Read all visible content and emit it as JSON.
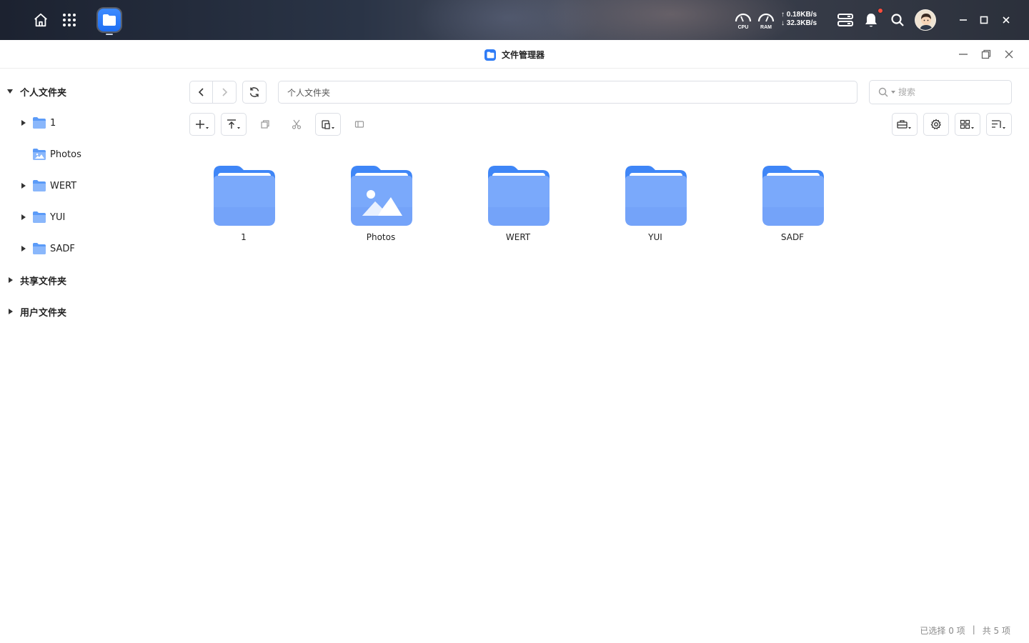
{
  "topbar": {
    "cpu_label": "CPU",
    "ram_label": "RAM",
    "upload_speed": "↑ 0.18KB/s",
    "download_speed": "↓ 32.3KB/s"
  },
  "window": {
    "title": "文件管理器"
  },
  "sidebar": {
    "personal": "个人文件夹",
    "children": [
      {
        "label": "1"
      },
      {
        "label": "Photos"
      },
      {
        "label": "WERT"
      },
      {
        "label": "YUI"
      },
      {
        "label": "SADF"
      }
    ],
    "shared": "共享文件夹",
    "users": "用户文件夹"
  },
  "toolbar": {
    "path": "个人文件夹",
    "search_placeholder": "搜索"
  },
  "items": [
    {
      "name": "1",
      "type": "folder"
    },
    {
      "name": "Photos",
      "type": "photos-folder"
    },
    {
      "name": "WERT",
      "type": "folder"
    },
    {
      "name": "YUI",
      "type": "folder"
    },
    {
      "name": "SADF",
      "type": "folder"
    }
  ],
  "status": {
    "selected": "已选择 0 项",
    "separator": "|",
    "total": "共 5 项"
  },
  "colors": {
    "folder_front": "#7aa9fb",
    "folder_back": "#3f86f7",
    "accent": "#2f7cf6",
    "notification": "#ff4d3d"
  }
}
